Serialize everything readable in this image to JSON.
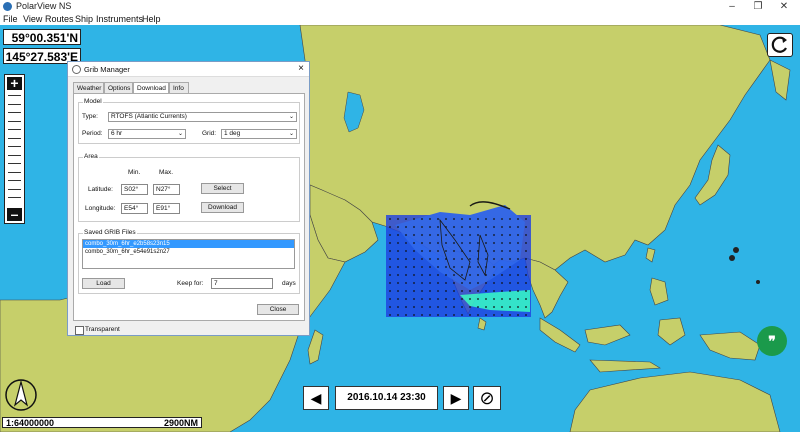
{
  "window": {
    "title": "PolarView NS"
  },
  "menu": [
    "File",
    "View",
    "Routes",
    "Ship",
    "Instruments",
    "Help"
  ],
  "coords": {
    "lat": "59°00.351'N",
    "lon": "145°27.583'E"
  },
  "dialog": {
    "title": "Grib Manager",
    "close": "×",
    "tabs": [
      "Weather",
      "Options",
      "Download",
      "Info"
    ],
    "model": {
      "group": "Model",
      "type_label": "Type:",
      "type_value": "RTOFS (Atlantic Currents)",
      "period_label": "Period:",
      "period_value": "6 hr",
      "grid_label": "Grid:",
      "grid_value": "1 deg"
    },
    "area": {
      "group": "Area",
      "min_label": "Min.",
      "max_label": "Max.",
      "lat_label": "Latitude:",
      "lat_min": "S02°",
      "lat_max": "N27°",
      "lon_label": "Longitude:",
      "lon_min": "E54°",
      "lon_max": "E91°",
      "select_btn": "Select",
      "download_btn": "Download"
    },
    "saved": {
      "group": "Saved GRIB Files",
      "files": [
        "combo_30m_6hr_e2b58s23n15",
        "combo_30m_6hr_e54e91s2n27"
      ],
      "load_btn": "Load",
      "keep_label": "Keep for:",
      "keep_value": "7",
      "days_label": "days",
      "close_btn": "Close"
    },
    "transparent_label": "Transparent"
  },
  "timebar": {
    "prev": "◀",
    "datetime": "2016.10.14 23:30",
    "next": "▶",
    "stop": "⊘"
  },
  "scale": {
    "ratio": "1:64000000",
    "distance": "2900NM"
  },
  "colors": {
    "sea": "#2fb4e6",
    "land": "#c6cf6a",
    "current_dark": "#1f3fe0",
    "current_mid": "#2e63ec",
    "current_light": "#35e6c8"
  }
}
